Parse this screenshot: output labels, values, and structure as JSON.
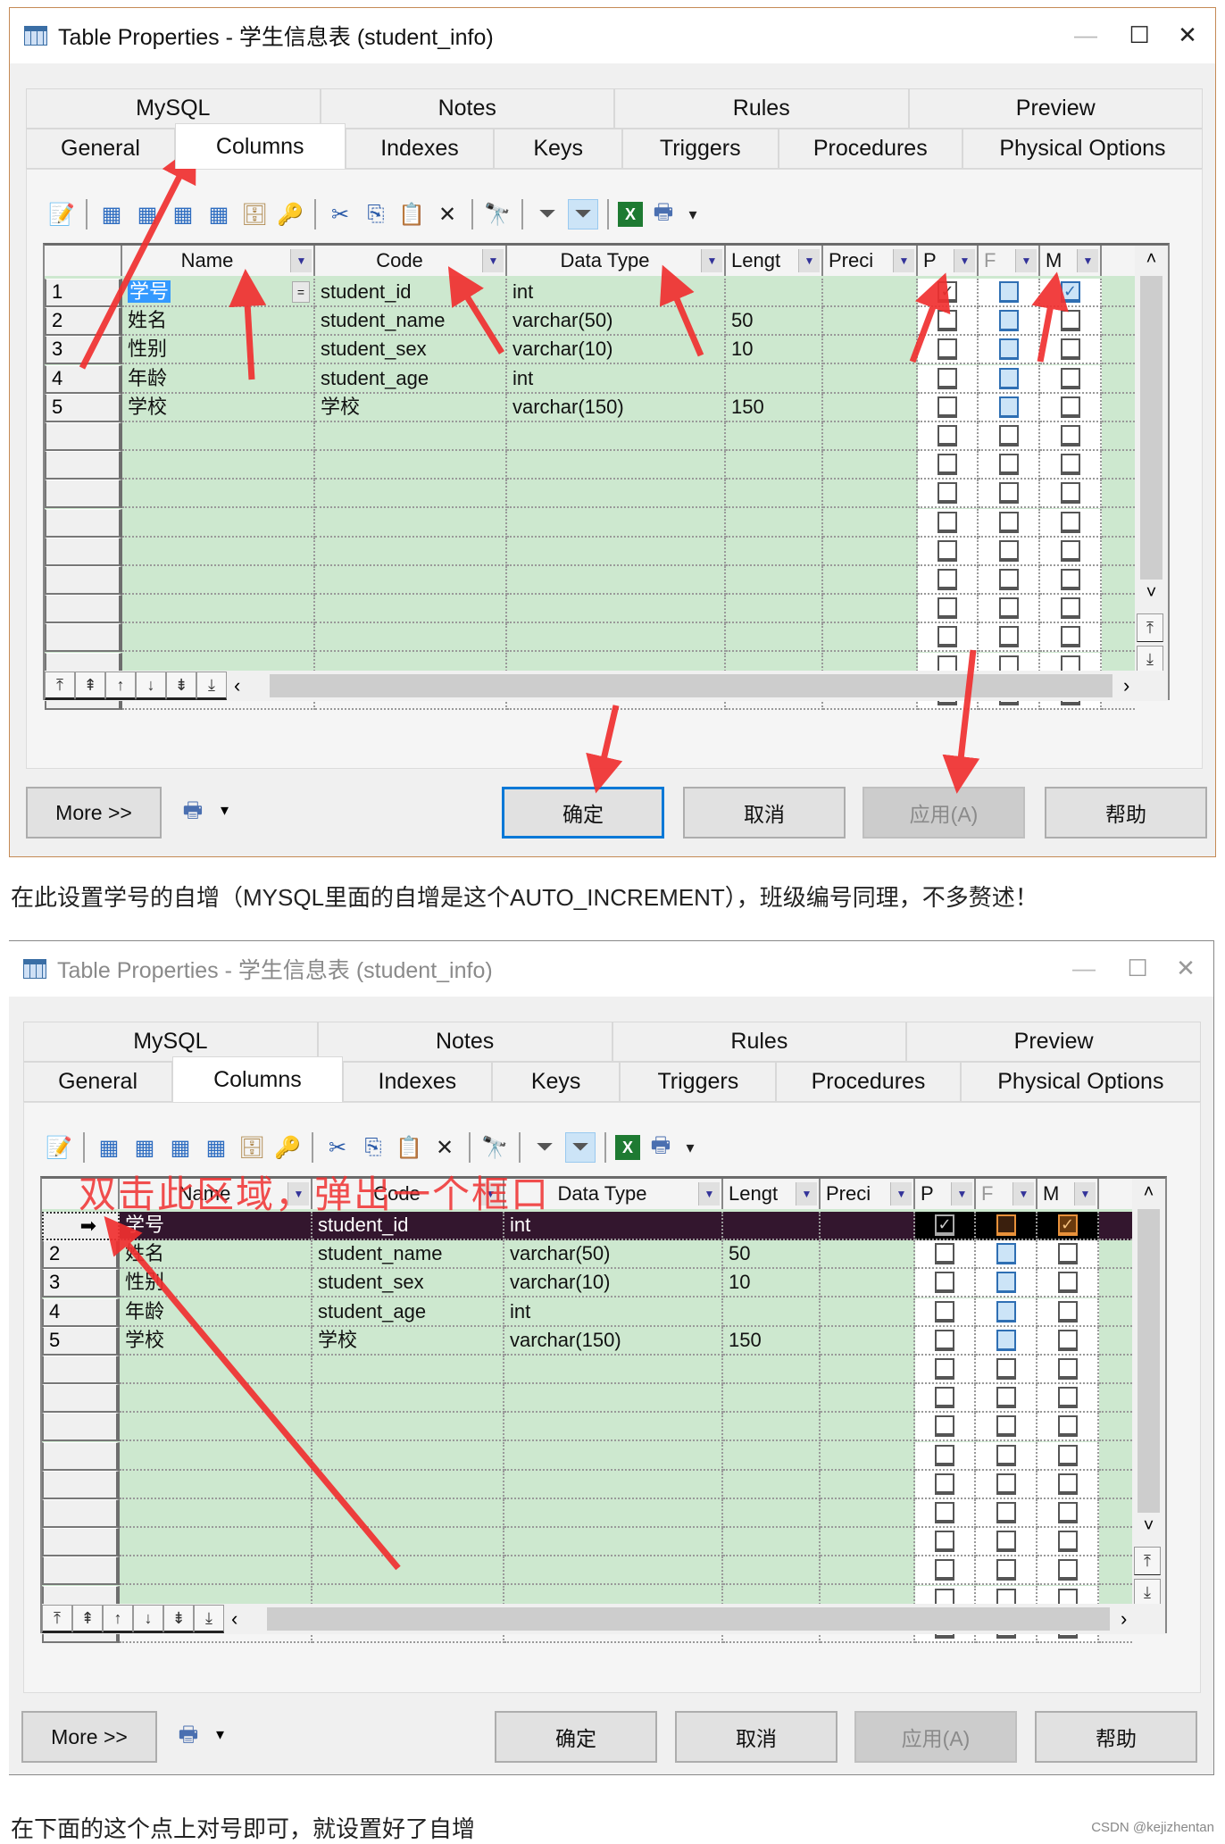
{
  "dialog1": {
    "title": "Table Properties - 学生信息表 (student_info)",
    "window_controls": {
      "minimize": "—",
      "maximize": "☐",
      "close": "✕"
    },
    "tabs_row1": [
      "MySQL",
      "Notes",
      "Rules",
      "Preview"
    ],
    "tabs_row2": [
      "General",
      "Columns",
      "Indexes",
      "Keys",
      "Triggers",
      "Procedures",
      "Physical Options"
    ],
    "active_tab": "Columns",
    "grid": {
      "headers": [
        "Name",
        "Code",
        "Data Type",
        "Lengt",
        "Preci",
        "P",
        "F",
        "M"
      ],
      "rows": [
        {
          "num": "1",
          "name": "学号",
          "code": "student_id",
          "type": "int",
          "length": "",
          "precision": "",
          "p": true,
          "f": false,
          "m": true
        },
        {
          "num": "2",
          "name": "姓名",
          "code": "student_name",
          "type": "varchar(50)",
          "length": "50",
          "precision": "",
          "p": false,
          "f": false,
          "m": false
        },
        {
          "num": "3",
          "name": "性别",
          "code": "student_sex",
          "type": "varchar(10)",
          "length": "10",
          "precision": "",
          "p": false,
          "f": false,
          "m": false
        },
        {
          "num": "4",
          "name": "年龄",
          "code": "student_age",
          "type": "int",
          "length": "",
          "precision": "",
          "p": false,
          "f": false,
          "m": false
        },
        {
          "num": "5",
          "name": "学校",
          "code": "学校",
          "type": "varchar(150)",
          "length": "150",
          "precision": "",
          "p": false,
          "f": false,
          "m": false
        }
      ],
      "edit_button": "="
    },
    "buttons": {
      "more": "More >>",
      "ok": "确定",
      "cancel": "取消",
      "apply": "应用(A)",
      "help": "帮助"
    }
  },
  "caption1": "在此设置学号的自增（MYSQL里面的自增是这个AUTO_INCREMENT），班级编号同理，不多赘述！",
  "dialog2": {
    "title": "Table Properties - 学生信息表 (student_info)",
    "window_controls": {
      "minimize": "—",
      "maximize": "☐",
      "close": "✕"
    },
    "tabs_row1": [
      "MySQL",
      "Notes",
      "Rules",
      "Preview"
    ],
    "tabs_row2": [
      "General",
      "Columns",
      "Indexes",
      "Keys",
      "Triggers",
      "Procedures",
      "Physical Options"
    ],
    "active_tab": "Columns",
    "annotation": "双击此区域，弹出一个框口",
    "selected_row_marker": "➡",
    "grid": {
      "headers": [
        "Name",
        "Code",
        "Data Type",
        "Lengt",
        "Preci",
        "P",
        "F",
        "M"
      ],
      "rows": [
        {
          "num": "➡",
          "name": "学号",
          "code": "student_id",
          "type": "int",
          "length": "",
          "precision": "",
          "p": true,
          "f": false,
          "m": true
        },
        {
          "num": "2",
          "name": "姓名",
          "code": "student_name",
          "type": "varchar(50)",
          "length": "50",
          "precision": "",
          "p": false,
          "f": false,
          "m": false
        },
        {
          "num": "3",
          "name": "性别",
          "code": "student_sex",
          "type": "varchar(10)",
          "length": "10",
          "precision": "",
          "p": false,
          "f": false,
          "m": false
        },
        {
          "num": "4",
          "name": "年龄",
          "code": "student_age",
          "type": "int",
          "length": "",
          "precision": "",
          "p": false,
          "f": false,
          "m": false
        },
        {
          "num": "5",
          "name": "学校",
          "code": "学校",
          "type": "varchar(150)",
          "length": "150",
          "precision": "",
          "p": false,
          "f": false,
          "m": false
        }
      ]
    },
    "buttons": {
      "more": "More >>",
      "ok": "确定",
      "cancel": "取消",
      "apply": "应用(A)",
      "help": "帮助"
    }
  },
  "caption2": "在下面的这个点上对号即可，就设置好了自增",
  "watermark": "CSDN @kejizhentan",
  "icons": {
    "properties": "📝",
    "insert_row": "▦",
    "add_row": "▦",
    "add_columns": "▦",
    "reuse_columns": "▦",
    "column_index": "🗄",
    "key": "🔑",
    "cut": "✂",
    "copy": "⎘",
    "paste": "📋",
    "delete": "✕",
    "find": "🔭",
    "filter_edit": "⏷",
    "filter_apply": "⏷",
    "excel": "X",
    "print": "🖶",
    "dropdown": "▾",
    "nav_first": "⤒",
    "nav_page_up": "⇞",
    "nav_up": "↑",
    "nav_down": "↓",
    "nav_page_down": "⇟",
    "nav_last": "⤓",
    "scroll_left": "‹",
    "scroll_right": "›",
    "scroll_up": "˄",
    "scroll_down": "˅",
    "scroll_top": "⤒",
    "scroll_bottom": "⤓",
    "checked": "✓",
    "column_dropdown": "▼"
  },
  "colors": {
    "grid_bg": "#cde8cf",
    "selected_row": "#33162e",
    "annotation_arrow": "#f03030",
    "default_button_border": "#0078d7"
  }
}
